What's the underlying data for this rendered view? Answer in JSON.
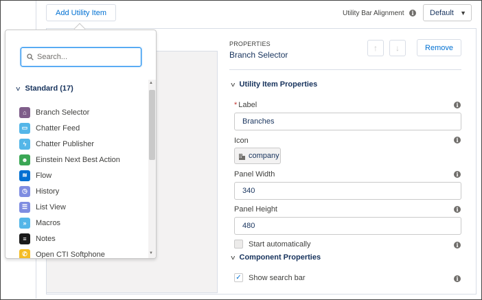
{
  "toolbar": {
    "add_label": "Add Utility Item",
    "alignment_label": "Utility Bar Alignment",
    "alignment_value": "Default"
  },
  "picker": {
    "search_placeholder": "Search...",
    "group_label": "Standard (17)",
    "items": [
      {
        "label": "Branch Selector",
        "icon": "branch-selector-icon",
        "color": "#7f5e8a"
      },
      {
        "label": "Chatter Feed",
        "icon": "chatter-feed-icon",
        "color": "#54b6e8"
      },
      {
        "label": "Chatter Publisher",
        "icon": "chatter-publisher-icon",
        "color": "#54b6e8"
      },
      {
        "label": "Einstein Next Best Action",
        "icon": "einstein-icon",
        "color": "#3ba755"
      },
      {
        "label": "Flow",
        "icon": "flow-icon",
        "color": "#0070d2"
      },
      {
        "label": "History",
        "icon": "history-icon",
        "color": "#7f8de1"
      },
      {
        "label": "List View",
        "icon": "list-view-icon",
        "color": "#7f8de1"
      },
      {
        "label": "Macros",
        "icon": "macros-icon",
        "color": "#54b6e8"
      },
      {
        "label": "Notes",
        "icon": "notes-icon",
        "color": "#1a1a1a"
      },
      {
        "label": "Open CTI Softphone",
        "icon": "softphone-icon",
        "color": "#f4bc25"
      }
    ]
  },
  "properties": {
    "heading": "PROPERTIES",
    "name": "Branch Selector",
    "remove_label": "Remove",
    "section_utility": "Utility Item Properties",
    "label_field": {
      "label": "Label",
      "value": "Branches"
    },
    "icon_field": {
      "label": "Icon",
      "value": "company"
    },
    "width_field": {
      "label": "Panel Width",
      "value": "340"
    },
    "height_field": {
      "label": "Panel Height",
      "value": "480"
    },
    "start_auto": {
      "label": "Start automatically",
      "checked": false
    },
    "section_component": "Component Properties",
    "show_search": {
      "label": "Show search bar",
      "checked": true
    }
  },
  "colors": {
    "accent": "#0070d2",
    "text": "#16325c"
  }
}
